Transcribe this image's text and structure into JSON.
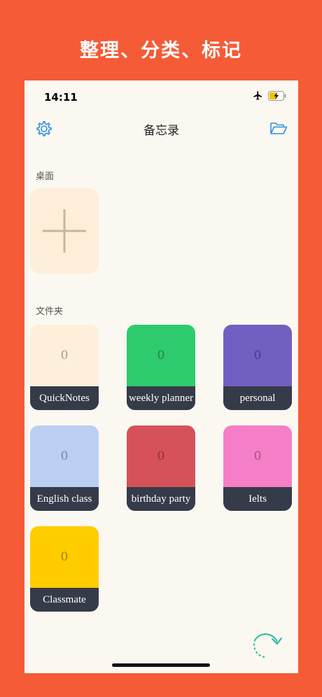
{
  "headline": "整理、分类、标记",
  "status_bar": {
    "time": "14:11"
  },
  "nav": {
    "title": "备忘录"
  },
  "sections": {
    "desktop_label": "桌面",
    "folders_label": "文件夹"
  },
  "folders": [
    {
      "name": "QuickNotes",
      "count": "0",
      "color": "#FDEFD9"
    },
    {
      "name": "weekly planner",
      "count": "0",
      "color": "#2ECB6E"
    },
    {
      "name": "personal",
      "count": "0",
      "color": "#725FC1"
    },
    {
      "name": "English class",
      "count": "0",
      "color": "#BBCFF3"
    },
    {
      "name": "birthday party",
      "count": "0",
      "color": "#D6525A"
    },
    {
      "name": "Ielts",
      "count": "0",
      "color": "#F57FC7"
    },
    {
      "name": "Classmate",
      "count": "0",
      "color": "#FFCC00"
    }
  ],
  "colors": {
    "background": "#F55B36",
    "screen": "#FBF8F1",
    "accent": "#2F8FE0",
    "card_label_bg": "#363B4A",
    "refresh": "#2BB7A3"
  },
  "icons": [
    "airplane-icon",
    "battery-charging-icon",
    "gear-icon",
    "folder-open-icon",
    "plus-icon",
    "refresh-icon"
  ]
}
